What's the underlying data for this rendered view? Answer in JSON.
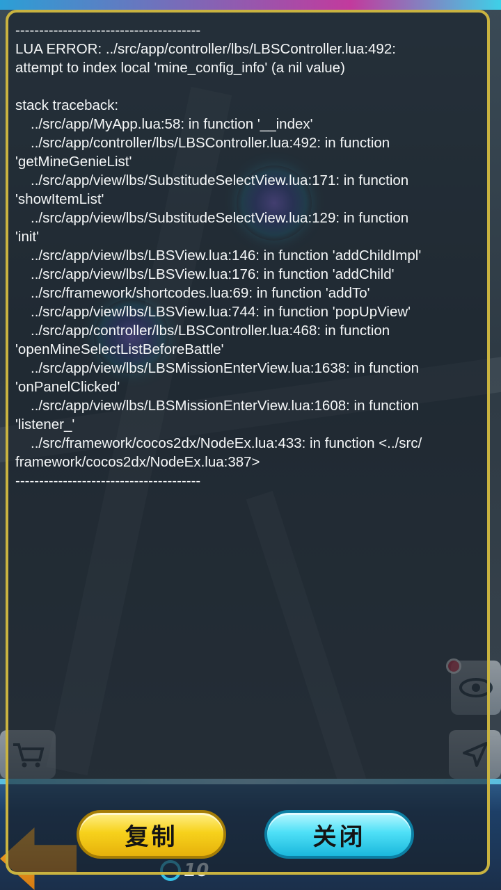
{
  "error_dialog": {
    "lines": [
      {
        "text": "---------------------------------------",
        "indent": false
      },
      {
        "text": "LUA ERROR: ../src/app/controller/lbs/LBSController.lua:492:",
        "indent": false
      },
      {
        "text": "attempt to index local 'mine_config_info' (a nil value)",
        "indent": false
      },
      {
        "text": "",
        "indent": false
      },
      {
        "text": "stack traceback:",
        "indent": false
      },
      {
        "text": "../src/app/MyApp.lua:58: in function '__index'",
        "indent": true
      },
      {
        "text": "../src/app/controller/lbs/LBSController.lua:492: in function",
        "indent": true
      },
      {
        "text": "'getMineGenieList'",
        "indent": false
      },
      {
        "text": "../src/app/view/lbs/SubstitudeSelectView.lua:171: in function",
        "indent": true
      },
      {
        "text": "'showItemList'",
        "indent": false
      },
      {
        "text": "../src/app/view/lbs/SubstitudeSelectView.lua:129: in function",
        "indent": true
      },
      {
        "text": "'init'",
        "indent": false
      },
      {
        "text": "../src/app/view/lbs/LBSView.lua:146: in function 'addChildImpl'",
        "indent": true
      },
      {
        "text": "../src/app/view/lbs/LBSView.lua:176: in function 'addChild'",
        "indent": true
      },
      {
        "text": "../src/framework/shortcodes.lua:69: in function 'addTo'",
        "indent": true
      },
      {
        "text": "../src/app/view/lbs/LBSView.lua:744: in function 'popUpView'",
        "indent": true
      },
      {
        "text": "../src/app/controller/lbs/LBSController.lua:468: in function",
        "indent": true
      },
      {
        "text": "'openMineSelectListBeforeBattle'",
        "indent": false
      },
      {
        "text": "../src/app/view/lbs/LBSMissionEnterView.lua:1638: in function",
        "indent": true
      },
      {
        "text": "'onPanelClicked'",
        "indent": false
      },
      {
        "text": "../src/app/view/lbs/LBSMissionEnterView.lua:1608: in function",
        "indent": true
      },
      {
        "text": "'listener_'",
        "indent": false
      },
      {
        "text": "../src/framework/cocos2dx/NodeEx.lua:433: in function <../src/",
        "indent": true
      },
      {
        "text": "framework/cocos2dx/NodeEx.lua:387>",
        "indent": false
      },
      {
        "text": "---------------------------------------",
        "indent": false
      }
    ],
    "copy_label": "复制",
    "close_label": "关闭"
  },
  "background": {
    "level_value": "10",
    "icons": [
      "eye-icon",
      "cart-icon",
      "navigate-arrow-icon",
      "back-arrow-icon",
      "genie-orb-icon"
    ]
  },
  "colors": {
    "frame_border": "#c9b340",
    "copy_button": "#f7d21c",
    "close_button": "#4fe0f7",
    "error_text": "#f5f7f8"
  }
}
